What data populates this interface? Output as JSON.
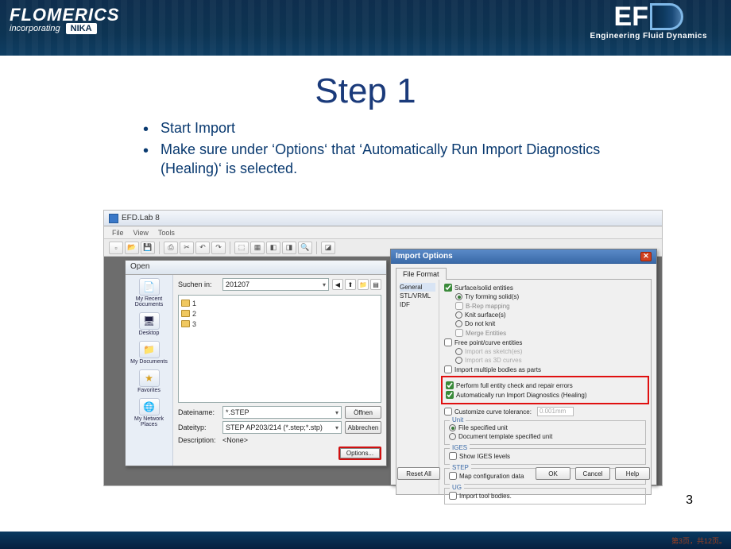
{
  "banner": {
    "brand_main": "FLOMERICS",
    "brand_sub": "incorporating",
    "brand_sub_logo": "NIKA",
    "efd_e": "E",
    "efd_f": "F",
    "tagline": "Engineering Fluid Dynamics"
  },
  "slide": {
    "title": "Step 1",
    "bullets": [
      "Start Import",
      "Make sure under ‘Options‘ that ‘Automatically Run Import Diagnostics (Healing)‘ is selected."
    ],
    "page_number": "3"
  },
  "app": {
    "window_title": "EFD.Lab 8",
    "menu": [
      "File",
      "View",
      "Tools"
    ]
  },
  "open_dialog": {
    "title": "Open",
    "look_in_label": "Suchen in:",
    "look_in_value": "201207",
    "sidebar": [
      {
        "label": "My Recent Documents",
        "glyph": "📄"
      },
      {
        "label": "Desktop",
        "glyph": "🖥"
      },
      {
        "label": "My Documents",
        "glyph": "📁"
      },
      {
        "label": "Favorites",
        "glyph": "★"
      },
      {
        "label": "My Network Places",
        "glyph": "🌐"
      }
    ],
    "folders": [
      "1",
      "2",
      "3"
    ],
    "filename_label": "Dateiname:",
    "filename_value": "*.STEP",
    "filetype_label": "Dateityp:",
    "filetype_value": "STEP AP203/214 (*.step;*.stp)",
    "desc_label": "Description:",
    "desc_value": "<None>",
    "open_btn": "Öffnen",
    "cancel_btn": "Abbrechen",
    "options_btn": "Options..."
  },
  "import_options": {
    "title": "Import Options",
    "tab": "File Format",
    "left_list": [
      "General",
      "STL/VRML",
      "IDF"
    ],
    "surface_solid": "Surface/solid entities",
    "try_forming": "Try forming solid(s)",
    "brep": "B-Rep mapping",
    "knit": "Knit surface(s)",
    "do_not_knit": "Do not knit",
    "merge": "Merge Entities",
    "free_point": "Free point/curve entities",
    "import_sketch": "Import as sketch(es)",
    "import_3d": "Import as 3D curves",
    "import_multiple": "Import multiple bodies as parts",
    "full_entity": "Perform full entity check and repair errors",
    "auto_diag": "Automatically run Import Diagnostics (Healing)",
    "custom_tol": "Customize curve tolerance:",
    "tol_value": "0.001mm",
    "unit_legend": "Unit",
    "unit_file": "File specified unit",
    "unit_doc": "Document template specified unit",
    "iges_legend": "IGES",
    "iges_show": "Show IGES levels",
    "step_legend": "STEP",
    "step_map": "Map configuration data",
    "ug_legend": "UG",
    "ug_import": "Import tool bodies.",
    "reset": "Reset All",
    "ok": "OK",
    "cancel": "Cancel",
    "help": "Help"
  },
  "footer_note": "第3页，共12页。"
}
